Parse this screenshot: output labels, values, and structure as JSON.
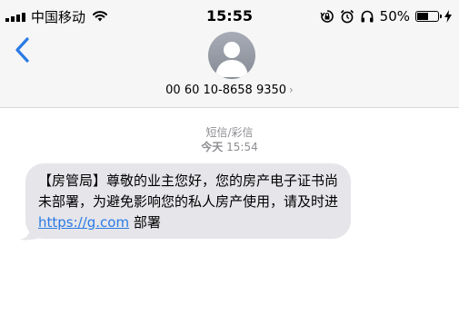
{
  "status_bar": {
    "carrier": "中国移动",
    "time": "15:55",
    "battery_percent": "50%",
    "battery_level": 0.5,
    "icons": [
      "signal-icon",
      "wifi-icon",
      "rotation-lock-icon",
      "alarm-icon",
      "headphones-icon",
      "battery-icon",
      "charging-icon"
    ]
  },
  "header": {
    "contact_number": "00 60 10-8658 9350",
    "chevron": "›",
    "icons": [
      "back-chevron-icon",
      "contact-avatar-icon"
    ]
  },
  "conversation": {
    "message_type": "短信/彩信",
    "day": "今天",
    "time": "15:54",
    "message": {
      "part1": "【房管局】尊敬的业主您好，您的房产电子证书尚未部署，为避免影响您的私人房产使用，请及时进 ",
      "link": "https://g.com",
      "part2": " 部署"
    }
  },
  "colors": {
    "accent": "#2a7be4",
    "bubble": "#e5e5ea",
    "header_bg": "#f6f6f6",
    "meta_text": "#8e8e93"
  }
}
